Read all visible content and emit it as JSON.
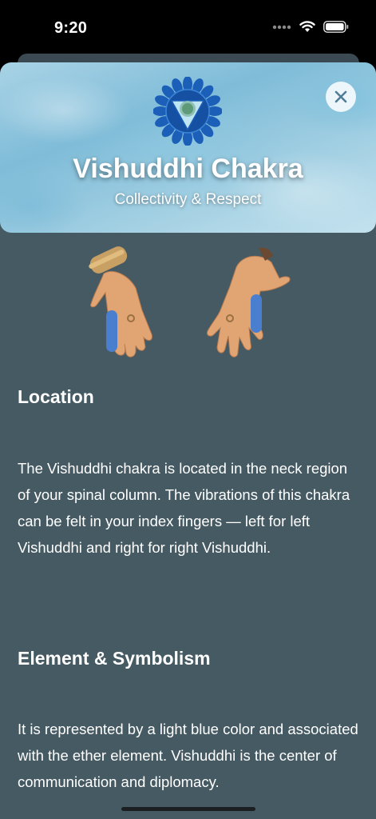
{
  "status_bar": {
    "time": "9:20",
    "icons": [
      "signal-dots-icon",
      "wifi-icon",
      "battery-icon"
    ]
  },
  "header": {
    "title": "Vishuddhi Chakra",
    "subtitle": "Collectivity & Respect",
    "symbol_icon": "vishuddhi-chakra-icon",
    "close_icon": "close-icon",
    "accent_color": "#1b5fb8"
  },
  "hands_image": {
    "icon": "hands-index-fingers-highlight",
    "highlight_color": "#4a7fd0"
  },
  "sections": [
    {
      "heading": "Location",
      "body": "The Vishuddhi chakra is located in the neck region of your spinal column. The vibrations of this chakra can be felt in your index fingers — left for left Vishuddhi and right for right Vishuddhi."
    },
    {
      "heading": "Element & Symbolism",
      "body": "It is represented by a light blue color and associated with the ether element. Vishuddhi is the center of communication and diplomacy."
    }
  ],
  "colors": {
    "sheet_background": "#455a63",
    "header_background": "#8fc6de"
  }
}
